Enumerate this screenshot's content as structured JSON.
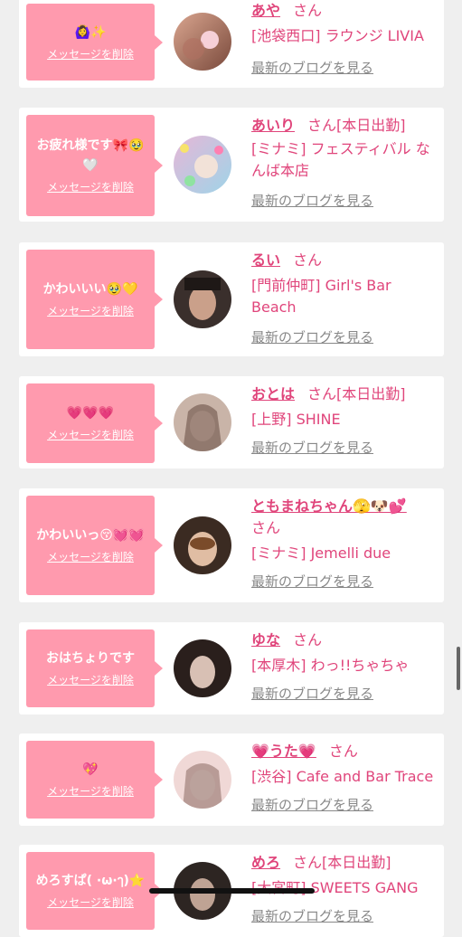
{
  "cards": [
    {
      "message": "🙆‍♀️✨",
      "delete_label": "メッセージを削除",
      "name": "あや",
      "honorific": "さん",
      "badge": "",
      "shop": "[池袋西口] ラウンジ LIVIA",
      "blog_label": "最新のブログを見る",
      "avatar_colors": [
        "#d9a58f",
        "#7a4a3c"
      ]
    },
    {
      "message": "お疲れ様です🎀🥹🤍",
      "delete_label": "メッセージを削除",
      "name": "あいり",
      "honorific": "さん",
      "badge": "[本日出勤]",
      "shop": "[ミナミ] フェスティバル なんば本店",
      "blog_label": "最新のブログを見る",
      "avatar_colors": [
        "#e6b7d7",
        "#9fd4e8"
      ]
    },
    {
      "message": "かわいいい🥹💛",
      "delete_label": "メッセージを削除",
      "name": "るい",
      "honorific": "さん",
      "badge": "",
      "shop": "[門前仲町] Girl's Bar Beach",
      "blog_label": "最新のブログを見る",
      "avatar_colors": [
        "#3a2f2c",
        "#caa08a"
      ]
    },
    {
      "message": "💗💗💗",
      "delete_label": "メッセージを削除",
      "name": "おとは",
      "honorific": "さん",
      "badge": "[本日出勤]",
      "shop": "[上野] SHINE",
      "blog_label": "最新のブログを見る",
      "avatar_colors": [
        "#c9b4a8",
        "#6d5247"
      ]
    },
    {
      "message": "かわいいっ😚💓💓",
      "delete_label": "メッセージを削除",
      "name": "ともまねちゃん🫣🐶💕",
      "honorific": "さん",
      "badge": "",
      "shop": "[ミナミ] Jemelli due",
      "blog_label": "最新のブログを見る",
      "avatar_colors": [
        "#e0bda3",
        "#3b2b22"
      ]
    },
    {
      "message": "おはちょりです",
      "delete_label": "メッセージを削除",
      "name": "ゆな",
      "honorific": "さん",
      "badge": "",
      "shop": "[本厚木] わっ!!ちゃちゃ",
      "blog_label": "最新のブログを見る",
      "avatar_colors": [
        "#d8c0b4",
        "#2a1f1c"
      ]
    },
    {
      "message": "💖",
      "delete_label": "メッセージを削除",
      "name": "💗うた💗",
      "honorific": "さん",
      "badge": "",
      "shop": "[渋谷] Cafe and Bar Trace",
      "blog_label": "最新のブログを見る",
      "avatar_colors": [
        "#f0d8d6",
        "#8a6a63"
      ]
    },
    {
      "message": "めろすぱ( ·ω·ๅ)⭐",
      "delete_label": "メッセージを削除",
      "name": "めろ",
      "honorific": "さん",
      "badge": "[本日出勤]",
      "shop": "[大宮町] SWEETS GANG",
      "blog_label": "最新のブログを見る",
      "avatar_colors": [
        "#2d2522",
        "#bfa394"
      ]
    }
  ]
}
